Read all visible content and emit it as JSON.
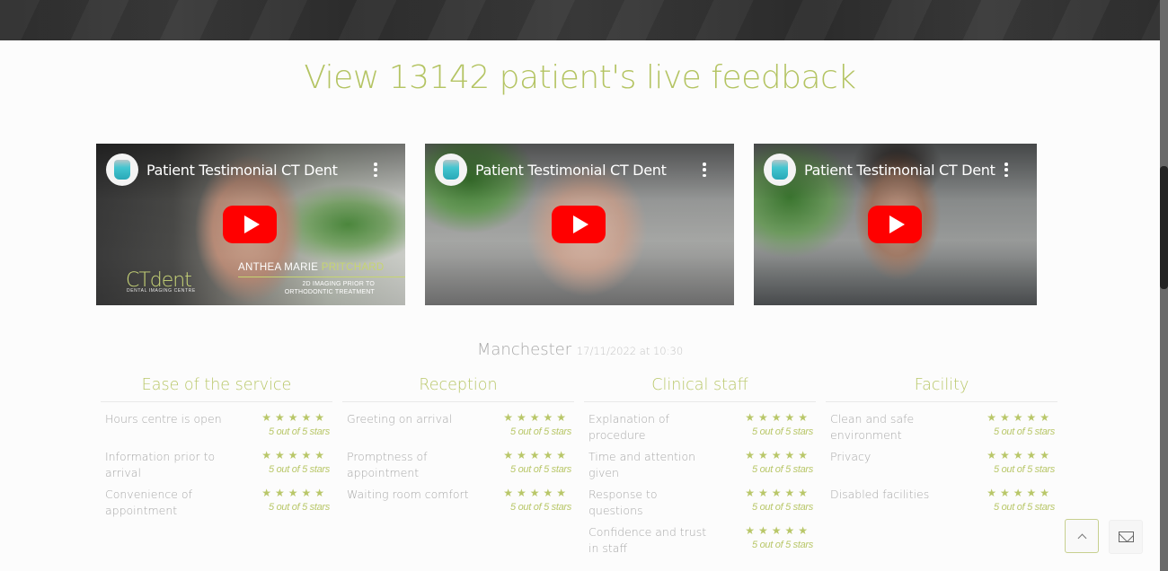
{
  "header": {
    "title": "View 13142 patient's live feedback"
  },
  "videos": [
    {
      "title": "Patient Testimonial CT Dent",
      "overlay_logo": "CTdent",
      "overlay_logo_sub": "DENTAL IMAGING CENTRE",
      "overlay_name_first": "ANTHEA MARIE",
      "overlay_name_last": "PRITCHARD",
      "overlay_line1": "2D IMAGING PRIOR TO",
      "overlay_line2": "ORTHODONTIC TREATMENT"
    },
    {
      "title": "Patient Testimonial CT Dent"
    },
    {
      "title": "Patient Testimonial CT Dent"
    }
  ],
  "feedback": {
    "location": "Manchester",
    "datetime": "17/11/2022 at 10:30",
    "categories": [
      {
        "title": "Ease of the service",
        "items": [
          {
            "label": "Hours centre is open",
            "stars": "★★★★★",
            "rating": 5,
            "rating_text": "5 out of 5 stars"
          },
          {
            "label": "Information prior to arrival",
            "stars": "★★★★★",
            "rating": 5,
            "rating_text": "5 out of 5 stars"
          },
          {
            "label": "Convenience of appointment",
            "stars": "★★★★★",
            "rating": 5,
            "rating_text": "5 out of 5 stars"
          }
        ]
      },
      {
        "title": "Reception",
        "items": [
          {
            "label": "Greeting on arrival",
            "stars": "★★★★★",
            "rating": 5,
            "rating_text": "5 out of 5 stars"
          },
          {
            "label": "Promptness of appointment",
            "stars": "★★★★★",
            "rating": 5,
            "rating_text": "5 out of 5 stars"
          },
          {
            "label": "Waiting room comfort",
            "stars": "★★★★★",
            "rating": 5,
            "rating_text": "5 out of 5 stars"
          }
        ]
      },
      {
        "title": "Clinical staff",
        "items": [
          {
            "label": "Explanation of procedure",
            "stars": "★★★★★",
            "rating": 5,
            "rating_text": "5 out of 5 stars"
          },
          {
            "label": "Time and attention given",
            "stars": "★★★★★",
            "rating": 5,
            "rating_text": "5 out of 5 stars"
          },
          {
            "label": "Response to questions",
            "stars": "★★★★★",
            "rating": 5,
            "rating_text": "5 out of 5 stars"
          },
          {
            "label": "Confidence and trust in staff",
            "stars": "★★★★★",
            "rating": 5,
            "rating_text": "5 out of 5 stars"
          }
        ]
      },
      {
        "title": "Facility",
        "items": [
          {
            "label": "Clean and safe environment",
            "stars": "★★★★★",
            "rating": 5,
            "rating_text": "5 out of 5 stars"
          },
          {
            "label": "Privacy",
            "stars": "★★★★★",
            "rating": 5,
            "rating_text": "5 out of 5 stars"
          },
          {
            "label": "Disabled facilities",
            "stars": "★★★★★",
            "rating": 5,
            "rating_text": "5 out of 5 stars"
          }
        ]
      }
    ]
  },
  "floating": {
    "back_to_top_icon": "chevron-up-icon",
    "contact_icon": "envelope-icon"
  },
  "colors": {
    "accent": "#b4c463",
    "youtube_red": "#ff0000",
    "text_muted": "#a8a8a8"
  }
}
